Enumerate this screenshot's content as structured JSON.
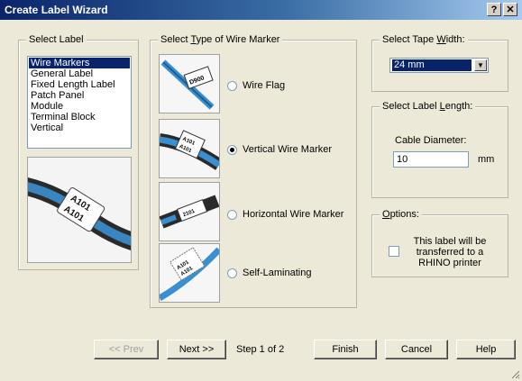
{
  "window": {
    "title": "Create Label Wizard",
    "help_glyph": "?",
    "close_glyph": "✕"
  },
  "select_label": {
    "legend": "Select Label",
    "items": [
      {
        "label": "Wire Markers",
        "selected": true
      },
      {
        "label": "General Label",
        "selected": false
      },
      {
        "label": "Fixed Length Label",
        "selected": false
      },
      {
        "label": "Patch Panel",
        "selected": false
      },
      {
        "label": "Module",
        "selected": false
      },
      {
        "label": "Terminal Block",
        "selected": false
      },
      {
        "label": "Vertical",
        "selected": false
      }
    ]
  },
  "wire_marker_type": {
    "legend_pre": "Select ",
    "legend_accel": "T",
    "legend_post": "ype of Wire Marker",
    "options": [
      {
        "label": "Wire Flag",
        "checked": false,
        "thumb_text": "D900"
      },
      {
        "label": "Vertical Wire Marker",
        "checked": true,
        "thumb_text": "A101"
      },
      {
        "label": "Horizontal Wire Marker",
        "checked": false,
        "thumb_text": "2101"
      },
      {
        "label": "Self-Laminating",
        "checked": false,
        "thumb_text": "A101"
      }
    ]
  },
  "tape_width": {
    "legend_pre": "Select Tape ",
    "legend_accel": "W",
    "legend_post": "idth:",
    "value": "24 mm",
    "arrow_glyph": "▼"
  },
  "label_length": {
    "legend_pre": "Select Label ",
    "legend_accel": "L",
    "legend_post": "ength:",
    "field_label": "Cable Diameter:",
    "value": "10",
    "unit": "mm"
  },
  "options": {
    "legend_accel": "O",
    "legend_post": "ptions:",
    "checkbox_label": "This label will be transferred to a RHINO printer",
    "checked": false
  },
  "preview_text": "A101",
  "footer": {
    "prev_label": "<< Prev",
    "next_label": "Next >>",
    "step_text": "Step 1 of 2",
    "finish_label": "Finish",
    "cancel_label": "Cancel",
    "help_label": "Help"
  },
  "colors": {
    "titlebar": "#0a246a",
    "selection": "#0a246a",
    "face": "#ece9d8",
    "wire_blue": "#3a8fd0"
  }
}
